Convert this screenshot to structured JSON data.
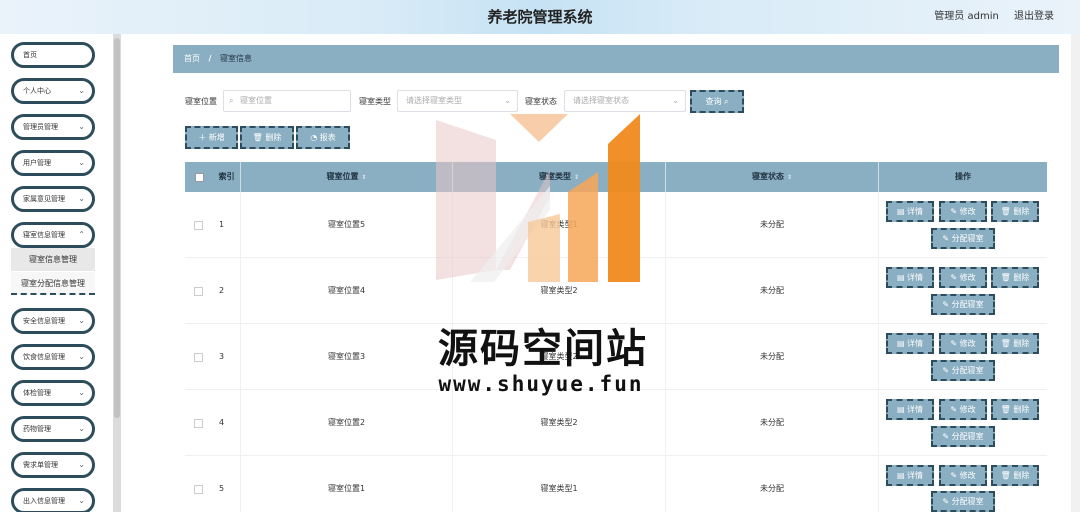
{
  "header": {
    "title": "养老院管理系统",
    "user_label": "管理员 admin",
    "logout_label": "退出登录"
  },
  "sidebar": {
    "items": [
      {
        "label": "首页"
      },
      {
        "label": "个人中心"
      },
      {
        "label": "管理员管理"
      },
      {
        "label": "用户管理"
      },
      {
        "label": "家属意见管理"
      },
      {
        "label": "寝室信息管理"
      },
      {
        "label": "安全信息管理"
      },
      {
        "label": "饮食信息管理"
      },
      {
        "label": "体检管理"
      },
      {
        "label": "药物管理"
      },
      {
        "label": "需求单管理"
      },
      {
        "label": "出入信息管理"
      }
    ],
    "subitems": [
      {
        "label": "寝室信息管理"
      },
      {
        "label": "寝室分配信息管理"
      }
    ]
  },
  "breadcrumb": {
    "home": "首页",
    "separator": "/",
    "current": "寝室信息"
  },
  "search": {
    "position_label": "寝室位置",
    "position_placeholder": "寝室位置",
    "type_label": "寝室类型",
    "type_placeholder": "请选择寝室类型",
    "status_label": "寝室状态",
    "status_placeholder": "请选择寝室状态",
    "query_button": "查询 ⌕"
  },
  "toolbar": {
    "add_label": "＋ 新增",
    "delete_label": "🗑 删除",
    "report_label": "◔ 报表"
  },
  "table": {
    "headers": {
      "index": "索引",
      "position": "寝室位置",
      "type": "寝室类型",
      "status": "寝室状态",
      "actions": "操作"
    },
    "sort_glyph": "⇕",
    "rows": [
      {
        "index": "1",
        "position": "寝室位置5",
        "type": "寝室类型1",
        "status": "未分配"
      },
      {
        "index": "2",
        "position": "寝室位置4",
        "type": "寝室类型2",
        "status": "未分配"
      },
      {
        "index": "3",
        "position": "寝室位置3",
        "type": "寝室类型2",
        "status": "未分配"
      },
      {
        "index": "4",
        "position": "寝室位置2",
        "type": "寝室类型2",
        "status": "未分配"
      },
      {
        "index": "5",
        "position": "寝室位置1",
        "type": "寝室类型1",
        "status": "未分配"
      }
    ],
    "row_actions": {
      "detail": "▤ 详情",
      "edit": "✎ 修改",
      "delete": "🗑 删除",
      "assign": "✎ 分配寝室"
    }
  },
  "watermark": {
    "text": "源码空间站",
    "url": "www.shuyue.fun"
  },
  "colors": {
    "accent": "#8aaec2",
    "border": "#2e4d5c",
    "watermark_orange": "#f08a1c"
  }
}
